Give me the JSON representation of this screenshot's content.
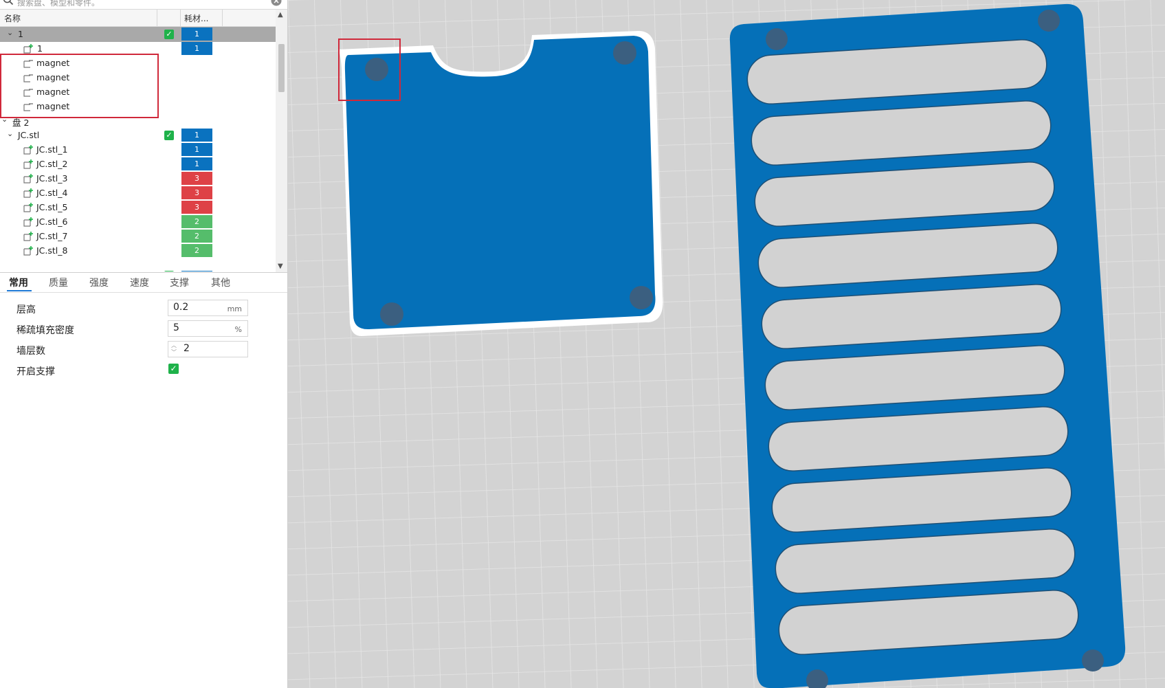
{
  "search": {
    "placeholder": "搜索盘、模型和零件。"
  },
  "tree": {
    "header": {
      "name": "名称",
      "filament": "耗材..."
    },
    "rows": [
      {
        "label": "1",
        "filament": "1"
      },
      {
        "label": "1",
        "filament": "1"
      },
      {
        "label": "magnet"
      },
      {
        "label": "magnet"
      },
      {
        "label": "magnet"
      },
      {
        "label": "magnet"
      },
      {
        "label": "盘 2"
      },
      {
        "label": "JC.stl",
        "filament": "1"
      },
      {
        "label": "JC.stl_1",
        "filament": "1"
      },
      {
        "label": "JC.stl_2",
        "filament": "1"
      },
      {
        "label": "JC.stl_3",
        "filament": "3"
      },
      {
        "label": "JC.stl_4",
        "filament": "3"
      },
      {
        "label": "JC.stl_5",
        "filament": "3"
      },
      {
        "label": "JC.stl_6",
        "filament": "2"
      },
      {
        "label": "JC.stl_7",
        "filament": "2"
      },
      {
        "label": "JC.stl_8",
        "filament": "2"
      }
    ]
  },
  "filament_colors": {
    "1": "#0a72bf",
    "2": "#55bd6b",
    "3": "#de4146"
  },
  "tabs": [
    "常用",
    "质量",
    "强度",
    "速度",
    "支撑",
    "其他"
  ],
  "settings": {
    "layer_height": {
      "label": "层高",
      "value": "0.2",
      "unit": "mm"
    },
    "infill_density": {
      "label": "稀疏填充密度",
      "value": "5",
      "unit": "%"
    },
    "wall_loops": {
      "label": "墙层数",
      "value": "2"
    },
    "enable_support": {
      "label": "开启支撑",
      "checked": true
    }
  },
  "colors": {
    "model_blue": "#0570b8",
    "accent": "#1f7ad6",
    "highlight_red": "#d0283a",
    "bed_grey": "#d4d4d4"
  }
}
